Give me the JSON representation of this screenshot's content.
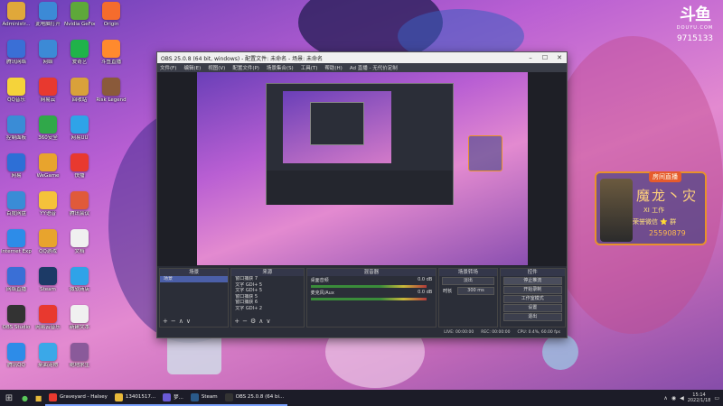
{
  "desktop": {
    "icons": [
      {
        "label": "Administr...",
        "icon": "user-folder-icon",
        "color": "#e0a83a"
      },
      {
        "label": "此电脑打开",
        "icon": "computer-icon",
        "color": "#3c8ad6"
      },
      {
        "label": "Nvidia GeForce",
        "icon": "nvidia-icon",
        "color": "#5ea83a"
      },
      {
        "label": "Origin",
        "icon": "origin-icon",
        "color": "#f56c2d"
      },
      {
        "label": "腾讯网络",
        "icon": "network-icon",
        "color": "#3a6fd6"
      },
      {
        "label": "网络",
        "icon": "globe-icon",
        "color": "#3c8ad6"
      },
      {
        "label": "爱奇艺",
        "icon": "iqiyi-icon",
        "color": "#20b34a"
      },
      {
        "label": "斗鱼直播",
        "icon": "douyu-icon",
        "color": "#ff8a2d"
      },
      {
        "label": "QQ音乐",
        "icon": "qq-music-icon",
        "color": "#f5d33a"
      },
      {
        "label": "网易云",
        "icon": "netease-icon",
        "color": "#e8392f"
      },
      {
        "label": "回收站",
        "icon": "recycle-bin-icon",
        "color": "#d9a13a"
      },
      {
        "label": "Risk Legend",
        "icon": "game-icon",
        "color": "#8a5a3a"
      },
      {
        "label": "控制面板",
        "icon": "control-panel-icon",
        "color": "#3a8cd6"
      },
      {
        "label": "360安全",
        "icon": "shield-icon",
        "color": "#30a84a"
      },
      {
        "label": "网易UU",
        "icon": "uu-icon",
        "color": "#2fa3e8"
      },
      {
        "label": "",
        "icon": "blank-icon",
        "color": "rgba(0,0,0,0)"
      },
      {
        "label": "网易",
        "icon": "netease-mail-icon",
        "color": "#2d6fd6"
      },
      {
        "label": "WeGame",
        "icon": "wegame-icon",
        "color": "#e8a42d"
      },
      {
        "label": "快播",
        "icon": "video-icon",
        "color": "#e8392f"
      },
      {
        "label": "",
        "icon": "blank-icon",
        "color": "rgba(0,0,0,0)"
      },
      {
        "label": "百度网盘",
        "icon": "baidu-cloud-icon",
        "color": "#3a8cd6"
      },
      {
        "label": "YY语音",
        "icon": "yy-icon",
        "color": "#f5c23a"
      },
      {
        "label": "腾讯会议",
        "icon": "meeting-icon",
        "color": "#e05a3a"
      },
      {
        "label": "",
        "icon": "blank-icon",
        "color": "rgba(0,0,0,0)"
      },
      {
        "label": "Internet Explorer",
        "icon": "ie-icon",
        "color": "#2d8ce8"
      },
      {
        "label": "QQ游戏",
        "icon": "qq-game-icon",
        "color": "#e8a42d"
      },
      {
        "label": "文档",
        "icon": "document-icon",
        "color": "#f0f0f0"
      },
      {
        "label": "",
        "icon": "blank-icon",
        "color": "rgba(0,0,0,0)"
      },
      {
        "label": "网络直播",
        "icon": "broadcast-icon",
        "color": "#3a6fd6"
      },
      {
        "label": "Steam",
        "icon": "steam-icon",
        "color": "#1c3a66"
      },
      {
        "label": "微软商店",
        "icon": "store-icon",
        "color": "#2fa3e8"
      },
      {
        "label": "",
        "icon": "blank-icon",
        "color": "rgba(0,0,0,0)"
      },
      {
        "label": "OBS Studio",
        "icon": "obs-icon",
        "color": "#333333"
      },
      {
        "label": "网易云音乐",
        "icon": "netease-music-icon",
        "color": "#e8392f"
      },
      {
        "label": "新建文本",
        "icon": "text-file-icon",
        "color": "#f0f0f0"
      },
      {
        "label": "",
        "icon": "blank-icon",
        "color": "rgba(0,0,0,0)"
      },
      {
        "label": "腾讯QQ",
        "icon": "qq-icon",
        "color": "#2d8ce8"
      },
      {
        "label": "桌面宠物",
        "icon": "pet-icon",
        "color": "#3aa8e8"
      },
      {
        "label": "绝地求生",
        "icon": "pubg-icon",
        "color": "#8a5a9a"
      },
      {
        "label": "",
        "icon": "blank-icon",
        "color": "rgba(0,0,0,0)"
      }
    ]
  },
  "douyu": {
    "logo_text": "斗鱼",
    "logo_sub": "DOUYU.COM",
    "room_id": "9715133"
  },
  "streamer_card": {
    "badge": "房间直播",
    "name": "魔龙丶灾",
    "line1": "XI 工作",
    "line2": "荣誉微信 ⭐ 群",
    "line3": "25590879"
  },
  "obs": {
    "title": "OBS 25.0.8 (64 bit, windows) - 配置文件: 未命名 - 场景: 未命名",
    "menus": [
      "文件(F)",
      "编辑(E)",
      "视图(V)",
      "配置文件(P)",
      "场景集合(S)",
      "工具(T)",
      "帮助(H)",
      "Ad 直播 - 无代价定制"
    ],
    "docks": {
      "scenes": {
        "title": "场景",
        "items": [
          "场景"
        ]
      },
      "sources": {
        "title": "来源",
        "items": [
          "窗口捕获 7",
          "文字 GDI+ 5",
          "文字 GDI+ 5",
          "窗口捕获 5",
          "窗口捕获 6",
          "文字 GDI+ 2"
        ]
      },
      "mixer": {
        "title": "混音器",
        "tracks": [
          {
            "name": "桌面音频",
            "level": "0.0 dB"
          },
          {
            "name": "麦克风/Aux",
            "level": "0.0 dB"
          }
        ]
      },
      "transitions": {
        "title": "场景转场",
        "type": "淡出",
        "duration_label": "时长",
        "duration": "300 ms"
      },
      "controls": {
        "title": "控件",
        "buttons": [
          "停止推流",
          "开始录制",
          "工作室模式",
          "设置",
          "退出"
        ]
      }
    },
    "status": {
      "live": "LIVE: 00:00:00",
      "rec": "REC: 00:00:00",
      "cpu": "CPU: 0.4%, 60.00 fps"
    }
  },
  "taskbar": {
    "tasks": [
      {
        "label": "Graveyard - Halsey",
        "icon": "music-icon",
        "color": "#e8392f"
      },
      {
        "label": "13401517...",
        "icon": "folder-icon",
        "color": "#e8b93a"
      },
      {
        "label": "梦...",
        "icon": "dream-icon",
        "color": "#6a5ad6"
      },
      {
        "label": "Steam",
        "icon": "steam-icon",
        "color": "#2a5a8a"
      },
      {
        "label": "OBS 25.0.8 (64 bi...",
        "icon": "obs-icon",
        "color": "#333333"
      }
    ],
    "time": "15:14",
    "date": "2022/1/18"
  }
}
